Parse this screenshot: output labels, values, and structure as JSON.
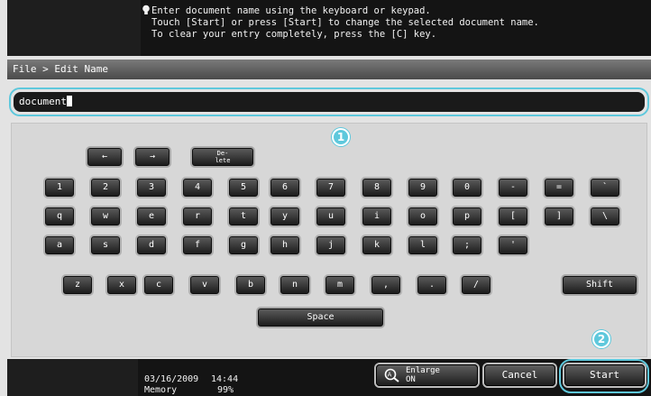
{
  "message": {
    "icon": "bulb-icon",
    "lines": [
      "Enter document name using the keyboard or keypad.",
      "Touch [Start] or press [Start] to change the selected document name.",
      "To clear your entry completely, press the [C] key."
    ]
  },
  "path": "File > Edit Name",
  "name_field": {
    "value": "document"
  },
  "keyboard": {
    "left_arrow": "←",
    "right_arrow": "→",
    "delete_top": "De-",
    "delete_bottom": "lete",
    "row1": [
      "1",
      "2",
      "3",
      "4",
      "5",
      "6",
      "7",
      "8",
      "9",
      "0",
      "-",
      "=",
      "`"
    ],
    "row2": [
      "q",
      "w",
      "e",
      "r",
      "t",
      "y",
      "u",
      "i",
      "o",
      "p",
      "[",
      "]",
      "\\"
    ],
    "row3": [
      "a",
      "s",
      "d",
      "f",
      "g",
      "h",
      "j",
      "k",
      "l",
      ";",
      "'"
    ],
    "row4": [
      "z",
      "x",
      "c",
      "v",
      "b",
      "n",
      "m",
      ",",
      ".",
      "/"
    ],
    "shift": "Shift",
    "space": "Space"
  },
  "markers": {
    "one": "1",
    "two": "2"
  },
  "status": {
    "date": "03/16/2009",
    "time": "14:44",
    "memory_label": "Memory",
    "memory_value": "99%"
  },
  "buttons": {
    "enlarge_top": "Enlarge",
    "enlarge_bottom": "ON",
    "cancel": "Cancel",
    "start": "Start"
  },
  "colors": {
    "highlight": "#5ec8dc",
    "key_dark": "#1c1c1c"
  }
}
